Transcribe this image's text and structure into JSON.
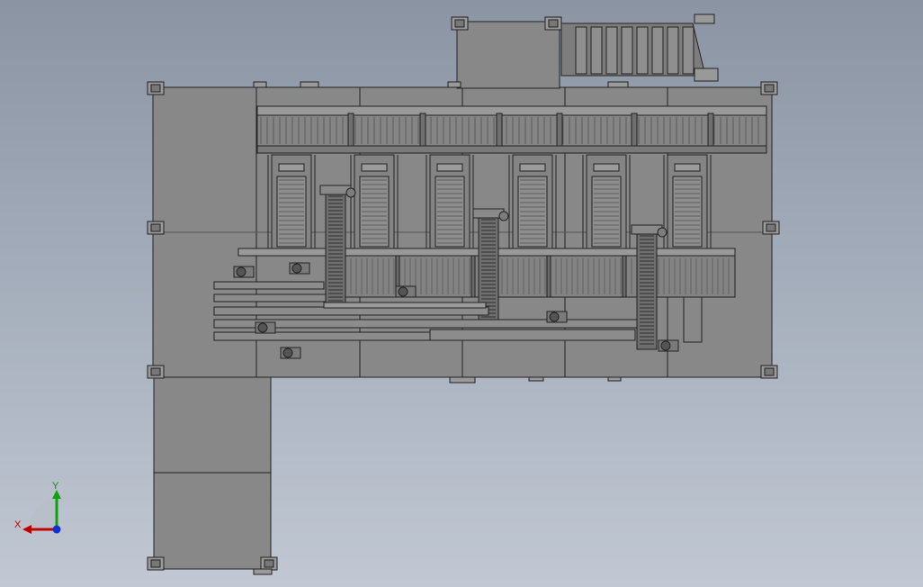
{
  "viewport": {
    "background_top": "#8b94a3",
    "background_bottom": "#c1c8d3",
    "model_fill": "#888888",
    "model_dark": "#6f6f6f",
    "edge_color": "#222222"
  },
  "triad": {
    "x_label": "X",
    "y_label": "Y",
    "x_color": "#c00000",
    "y_color": "#10a010",
    "z_color": "#1030d0"
  },
  "model": {
    "upper_lanes": 6,
    "chain_risers": 3,
    "inclined_conveyor_slats": 8
  }
}
